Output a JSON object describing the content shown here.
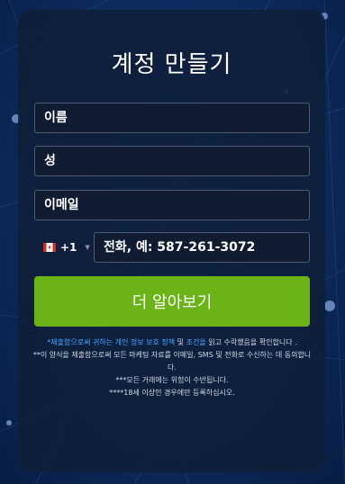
{
  "form": {
    "title": "계정 만들기",
    "first_name_placeholder": "이름",
    "last_name_placeholder": "성",
    "email_placeholder": "이메일",
    "country_code": "+1",
    "country_flag": "canada-flag-icon",
    "phone_placeholder": "전화, 예: 587-261-3072",
    "submit_label": "더 알아보기"
  },
  "legal": {
    "line1_link1": "*제출함으로써 귀하는 개인 정보 보호 정책",
    "line1_mid": " 및 ",
    "line1_link2": "조건을",
    "line1_end": " 읽고 수락했음을 확인합니다 .",
    "line2": "**이 양식을 제출함으로써 모든 마케팅 자료를 이메일, SMS 및 전화로 수신하는 데 동의합니다.",
    "line3": "***모든 거래에는 위험이 수반됩니다.",
    "line4": "****18세 이상인 경우에만 등록하십시오."
  },
  "colors": {
    "accent_green": "#6ab417",
    "link_blue": "#47a8ff",
    "background": "#0d2a5c",
    "card": "#0e1f3a"
  }
}
